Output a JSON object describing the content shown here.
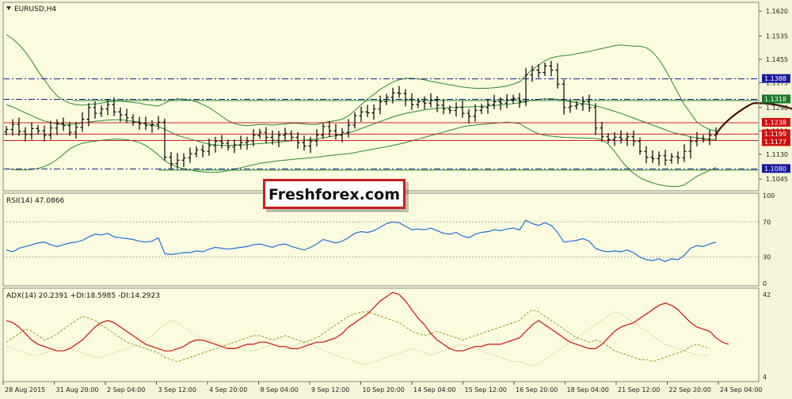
{
  "colors": {
    "background": "#f4f4d8",
    "panel": "#fbfbe0",
    "candles": "#000000",
    "bollinger": "#2e8b2e",
    "rsi": "#1e6fd9",
    "adx": "#d01010",
    "plus_di": "#9a9a1a",
    "minus_di": "#d8c488",
    "level_blue": "#1a1a99",
    "level_green": "#1a8a2a",
    "level_red": "#d02020",
    "label_blue": "#1a1aa0",
    "label_green": "#1a7a2a",
    "label_red": "#d01010",
    "forecast": "#4a0a0a",
    "logo_red": "#c61f1f"
  },
  "logo": {
    "text": "Freshforex.com"
  },
  "chart_data": [
    {
      "type": "line",
      "panel": "main",
      "title": "EURUSD,H4",
      "chart_style": "ohlc-bars",
      "ylim": [
        1.1005,
        1.165
      ],
      "y_ticks": [
        1.162,
        1.1535,
        1.1455,
        1.1375,
        1.129,
        1.121,
        1.113,
        1.1045
      ],
      "grid": false,
      "closes": [
        1.1215,
        1.1232,
        1.1208,
        1.1198,
        1.1218,
        1.121,
        1.1195,
        1.122,
        1.1235,
        1.1228,
        1.1205,
        1.1222,
        1.125,
        1.129,
        1.127,
        1.1285,
        1.13,
        1.1275,
        1.1265,
        1.1255,
        1.124,
        1.1235,
        1.1228,
        1.1232,
        1.124,
        1.112,
        1.1098,
        1.111,
        1.1118,
        1.1132,
        1.1145,
        1.114,
        1.116,
        1.1175,
        1.1168,
        1.1155,
        1.1162,
        1.117,
        1.1175,
        1.1195,
        1.1205,
        1.1188,
        1.1178,
        1.1195,
        1.12,
        1.1188,
        1.117,
        1.1158,
        1.1175,
        1.1195,
        1.1225,
        1.121,
        1.1195,
        1.1205,
        1.123,
        1.1262,
        1.1275,
        1.1272,
        1.1285,
        1.131,
        1.1325,
        1.134,
        1.1338,
        1.1318,
        1.13,
        1.131,
        1.1305,
        1.1315,
        1.1298,
        1.1285,
        1.128,
        1.129,
        1.127,
        1.126,
        1.128,
        1.129,
        1.13,
        1.131,
        1.1305,
        1.1315,
        1.1322,
        1.131,
        1.1402,
        1.1418,
        1.141,
        1.1432,
        1.1418,
        1.137,
        1.129,
        1.1295,
        1.13,
        1.131,
        1.129,
        1.122,
        1.119,
        1.118,
        1.1188,
        1.1182,
        1.119,
        1.1175,
        1.114,
        1.112,
        1.1115,
        1.1125,
        1.111,
        1.1122,
        1.1118,
        1.114,
        1.1175,
        1.1185,
        1.1182,
        1.1195,
        1.1198
      ],
      "bb_upper": [
        1.154,
        1.1525,
        1.1505,
        1.148,
        1.145,
        1.1415,
        1.1385,
        1.1355,
        1.133,
        1.1315,
        1.1305,
        1.13,
        1.1298,
        1.13,
        1.1302,
        1.1305,
        1.131,
        1.1312,
        1.1312,
        1.131,
        1.1308,
        1.1305,
        1.13,
        1.1298,
        1.1295,
        1.1305,
        1.1315,
        1.132,
        1.1318,
        1.1315,
        1.131,
        1.13,
        1.129,
        1.1275,
        1.126,
        1.1245,
        1.1235,
        1.123,
        1.1228,
        1.123,
        1.1232,
        1.1232,
        1.123,
        1.1232,
        1.1234,
        1.1236,
        1.1236,
        1.1234,
        1.1232,
        1.1232,
        1.1238,
        1.1242,
        1.1245,
        1.125,
        1.1262,
        1.128,
        1.13,
        1.1318,
        1.1335,
        1.1352,
        1.1365,
        1.1378,
        1.1385,
        1.139,
        1.139,
        1.1388,
        1.1385,
        1.138,
        1.1376,
        1.1372,
        1.1368,
        1.1364,
        1.136,
        1.1358,
        1.1356,
        1.1356,
        1.1356,
        1.1358,
        1.136,
        1.1364,
        1.137,
        1.1378,
        1.14,
        1.142,
        1.1435,
        1.145,
        1.146,
        1.1465,
        1.1468,
        1.147,
        1.1474,
        1.1478,
        1.1482,
        1.1487,
        1.1492,
        1.1497,
        1.1502,
        1.1504,
        1.1502,
        1.15,
        1.15,
        1.1495,
        1.148,
        1.1455,
        1.142,
        1.138,
        1.134,
        1.13,
        1.127,
        1.124,
        1.1225,
        1.1215,
        1.121
      ],
      "bb_middle": [
        1.13,
        1.1292,
        1.1282,
        1.1272,
        1.1262,
        1.1252,
        1.1244,
        1.1238,
        1.1234,
        1.1232,
        1.1232,
        1.1234,
        1.1237,
        1.124,
        1.1243,
        1.1245,
        1.1247,
        1.1248,
        1.1248,
        1.1246,
        1.1243,
        1.124,
        1.1235,
        1.123,
        1.1225,
        1.1215,
        1.1205,
        1.1195,
        1.1188,
        1.1182,
        1.1176,
        1.117,
        1.1165,
        1.1162,
        1.116,
        1.116,
        1.1161,
        1.1162,
        1.1163,
        1.1165,
        1.1167,
        1.1168,
        1.117,
        1.1172,
        1.1174,
        1.1176,
        1.1177,
        1.1178,
        1.118,
        1.1182,
        1.1186,
        1.119,
        1.1194,
        1.1198,
        1.1204,
        1.121,
        1.1218,
        1.1226,
        1.1234,
        1.1242,
        1.125,
        1.1258,
        1.1264,
        1.127,
        1.1274,
        1.1278,
        1.1282,
        1.1285,
        1.1287,
        1.1289,
        1.129,
        1.1291,
        1.1292,
        1.1292,
        1.1293,
        1.1294,
        1.1295,
        1.1297,
        1.1299,
        1.1301,
        1.1303,
        1.1306,
        1.131,
        1.1315,
        1.1318,
        1.132,
        1.132,
        1.1318,
        1.1314,
        1.131,
        1.1307,
        1.1304,
        1.13,
        1.1296,
        1.129,
        1.1284,
        1.1277,
        1.127,
        1.1262,
        1.1254,
        1.1246,
        1.1238,
        1.123,
        1.1222,
        1.1214,
        1.1206,
        1.12,
        1.1195,
        1.119,
        1.1186,
        1.1183,
        1.1181,
        1.118
      ],
      "bb_lower": [
        1.108,
        1.1078,
        1.1076,
        1.1076,
        1.1078,
        1.1082,
        1.1088,
        1.1098,
        1.1112,
        1.113,
        1.1148,
        1.116,
        1.1168,
        1.1172,
        1.1175,
        1.1178,
        1.118,
        1.1182,
        1.1182,
        1.118,
        1.1176,
        1.117,
        1.116,
        1.1145,
        1.1128,
        1.1108,
        1.1095,
        1.1086,
        1.108,
        1.1076,
        1.1072,
        1.107,
        1.1068,
        1.1068,
        1.107,
        1.1074,
        1.1079,
        1.1084,
        1.1089,
        1.1094,
        1.1099,
        1.1102,
        1.1105,
        1.1108,
        1.111,
        1.1112,
        1.1114,
        1.1116,
        1.1118,
        1.112,
        1.1123,
        1.1126,
        1.1128,
        1.113,
        1.1132,
        1.1136,
        1.114,
        1.1144,
        1.1148,
        1.1152,
        1.1156,
        1.116,
        1.1165,
        1.117,
        1.1176,
        1.1182,
        1.1188,
        1.1194,
        1.12,
        1.1206,
        1.1212,
        1.1218,
        1.1224,
        1.1228,
        1.123,
        1.1232,
        1.1234,
        1.1236,
        1.1238,
        1.124,
        1.1238,
        1.1235,
        1.1222,
        1.121,
        1.12,
        1.1195,
        1.1192,
        1.119,
        1.1188,
        1.1187,
        1.1186,
        1.1186,
        1.1185,
        1.1184,
        1.118,
        1.1165,
        1.114,
        1.111,
        1.1085,
        1.1065,
        1.105,
        1.104,
        1.1032,
        1.1026,
        1.1022,
        1.102,
        1.102,
        1.1025,
        1.104,
        1.1055,
        1.1065,
        1.1075,
        1.1085
      ],
      "levels": [
        {
          "value": 1.1388,
          "label": "1.1388",
          "style": "dash-dot",
          "color_key": "level_blue",
          "label_color_key": "label_blue"
        },
        {
          "value": 1.1318,
          "label": "1.1318",
          "style": "dash-dot",
          "color_key": "level_blue",
          "label_color_key": "label_green"
        },
        {
          "value": 1.1238,
          "label": "1.1238",
          "style": "solid",
          "color_key": "level_red",
          "label_color_key": "label_red"
        },
        {
          "value": 1.1199,
          "label": "1.1199",
          "style": "solid",
          "color_key": "level_red",
          "label_color_key": "label_red"
        },
        {
          "value": 1.1177,
          "label": "1.1177",
          "style": "solid",
          "color_key": "level_red",
          "label_color_key": "label_red"
        },
        {
          "value": 1.108,
          "label": "1.1080",
          "style": "dash-dot",
          "color_key": "level_blue",
          "label_color_key": "label_blue"
        }
      ],
      "green_levels": [
        1.1318,
        1.108
      ],
      "forecast_path": [
        [
          0,
          1.1198
        ],
        [
          6,
          1.1305
        ],
        [
          11,
          1.131
        ],
        [
          16,
          1.1235
        ]
      ]
    },
    {
      "type": "line",
      "panel": "rsi",
      "title": "RSI(14) 47.0866",
      "ylim": [
        0,
        100
      ],
      "y_ticks": [
        100,
        70,
        30,
        0
      ],
      "guide_levels": [
        70,
        30
      ],
      "values": [
        38,
        36,
        40,
        42,
        44,
        46,
        47,
        44,
        42,
        44,
        46,
        47,
        49,
        53,
        56,
        55,
        57,
        53,
        52,
        51,
        50,
        48,
        47,
        48,
        52,
        34,
        33,
        34,
        35,
        35,
        37,
        36,
        39,
        41,
        40,
        39,
        40,
        41,
        42,
        44,
        45,
        43,
        41,
        44,
        45,
        42,
        40,
        38,
        41,
        45,
        50,
        48,
        46,
        48,
        52,
        57,
        59,
        58,
        60,
        64,
        68,
        70,
        69,
        65,
        61,
        62,
        61,
        63,
        60,
        57,
        56,
        58,
        54,
        52,
        56,
        58,
        59,
        61,
        60,
        62,
        63,
        61,
        72,
        68,
        66,
        69,
        66,
        58,
        47,
        48,
        49,
        51,
        48,
        40,
        37,
        36,
        37,
        36,
        38,
        35,
        30,
        27,
        26,
        28,
        25,
        28,
        27,
        32,
        40,
        43,
        42,
        45,
        47
      ]
    },
    {
      "type": "line",
      "panel": "adx",
      "title": "ADX(14) 20.2391 +DI:18.5985 -DI:14.2923",
      "ylim": [
        4,
        42
      ],
      "y_ticks": [
        42,
        4
      ],
      "adx": [
        30,
        29,
        27,
        24,
        21,
        19,
        18,
        17,
        16,
        16,
        17,
        19,
        21,
        24,
        27,
        29,
        30,
        29,
        27,
        25,
        23,
        21,
        19,
        18,
        17,
        16,
        16,
        17,
        18,
        20,
        21,
        21,
        20,
        19,
        18,
        17,
        17,
        18,
        19,
        19,
        20,
        20,
        19,
        18,
        18,
        17,
        17,
        18,
        19,
        20,
        20,
        21,
        22,
        24,
        27,
        29,
        31,
        33,
        36,
        39,
        41,
        43,
        42,
        39,
        35,
        31,
        28,
        24,
        21,
        19,
        17,
        16,
        16,
        17,
        18,
        18,
        19,
        19,
        19,
        20,
        21,
        22,
        25,
        28,
        30,
        28,
        26,
        24,
        22,
        20,
        19,
        18,
        17,
        17,
        19,
        22,
        25,
        27,
        28,
        29,
        31,
        33,
        35,
        37,
        38,
        37,
        35,
        32,
        29,
        27,
        26,
        25,
        22,
        20,
        19
      ],
      "plus_di": [
        20,
        22,
        24,
        26,
        25,
        23,
        21,
        22,
        24,
        26,
        28,
        30,
        32,
        31,
        30,
        28,
        26,
        24,
        22,
        20,
        19,
        18,
        17,
        16,
        15,
        13,
        12,
        11,
        12,
        13,
        14,
        15,
        16,
        17,
        18,
        19,
        20,
        21,
        22,
        23,
        23,
        22,
        21,
        22,
        23,
        22,
        21,
        20,
        21,
        22,
        24,
        26,
        28,
        30,
        32,
        33,
        34,
        34,
        33,
        32,
        31,
        30,
        29,
        27,
        25,
        24,
        23,
        24,
        25,
        24,
        23,
        22,
        21,
        22,
        23,
        24,
        25,
        26,
        27,
        28,
        29,
        30,
        33,
        35,
        34,
        32,
        30,
        28,
        26,
        24,
        22,
        21,
        20,
        21,
        20,
        18,
        16,
        15,
        14,
        13,
        12,
        12,
        11,
        12,
        13,
        14,
        15,
        16,
        18,
        19,
        18,
        17
      ],
      "minus_di": [
        18,
        17,
        16,
        15,
        14,
        14,
        15,
        16,
        17,
        18,
        17,
        16,
        15,
        14,
        13,
        13,
        14,
        15,
        16,
        17,
        18,
        19,
        21,
        23,
        26,
        28,
        30,
        29,
        27,
        25,
        23,
        22,
        21,
        20,
        19,
        18,
        17,
        17,
        16,
        16,
        17,
        18,
        19,
        18,
        17,
        18,
        19,
        20,
        19,
        18,
        16,
        15,
        14,
        13,
        12,
        11,
        10,
        10,
        11,
        12,
        13,
        14,
        15,
        16,
        17,
        16,
        15,
        14,
        15,
        16,
        17,
        18,
        19,
        18,
        17,
        16,
        15,
        14,
        13,
        12,
        11,
        11,
        10,
        9,
        10,
        12,
        14,
        16,
        18,
        20,
        22,
        24,
        26,
        28,
        30,
        32,
        34,
        33,
        31,
        29,
        27,
        25,
        23,
        21,
        19,
        18,
        17,
        16,
        15,
        14,
        14,
        14
      ]
    }
  ],
  "x_axis": {
    "labels": [
      "28 Aug 2015",
      "31 Aug 20:00",
      "2 Sep 04:00",
      "3 Sep 12:00",
      "4 Sep 20:00",
      "8 Sep 04:00",
      "9 Sep 12:00",
      "10 Sep 20:00",
      "14 Sep 04:00",
      "15 Sep 12:00",
      "16 Sep 20:00",
      "18 Sep 04:00",
      "21 Sep 12:00",
      "22 Sep 20:00",
      "24 Sep 04:00"
    ]
  }
}
